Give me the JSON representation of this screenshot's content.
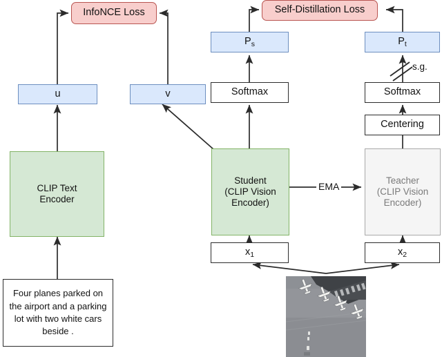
{
  "diagram": {
    "title": "CLIP self-distillation training diagram",
    "colors": {
      "loss_fill": "#f8cecc",
      "loss_stroke": "#b85450",
      "blue_fill": "#dae8fc",
      "blue_stroke": "#6c8ebf",
      "green_fill": "#d5e8d4",
      "green_stroke": "#82b366",
      "gray_fill": "#f5f5f5",
      "gray_stroke": "#a8a8a8",
      "white_fill": "#ffffff",
      "line": "#2b2b2b"
    },
    "nodes": {
      "infonce_loss": "InfoNCE Loss",
      "self_distillation_loss": "Self-Distillation Loss",
      "u": "u",
      "v": "v",
      "p_s_base": "P",
      "p_s_sub": "s",
      "p_t_base": "P",
      "p_t_sub": "t",
      "softmax_student": "Softmax",
      "softmax_teacher": "Softmax",
      "centering": "Centering",
      "clip_text_encoder": "CLIP Text\nEncoder",
      "student": "Student\n(CLIP Vision\nEncoder)",
      "teacher": "Teacher\n(CLIP Vision\nEncoder)",
      "x1_base": "x",
      "x1_sub": "1",
      "x2_base": "x",
      "x2_sub": "2",
      "text_caption": "Four planes parked on the airport and a parking lot with two white cars beside ."
    },
    "edge_labels": {
      "ema": "EMA",
      "stop_gradient": "s.g."
    },
    "image_thumbnail": {
      "name": "aerial-airport-planes-image",
      "description": "Aerial satellite photo of four parked planes on an airport tarmac"
    }
  }
}
